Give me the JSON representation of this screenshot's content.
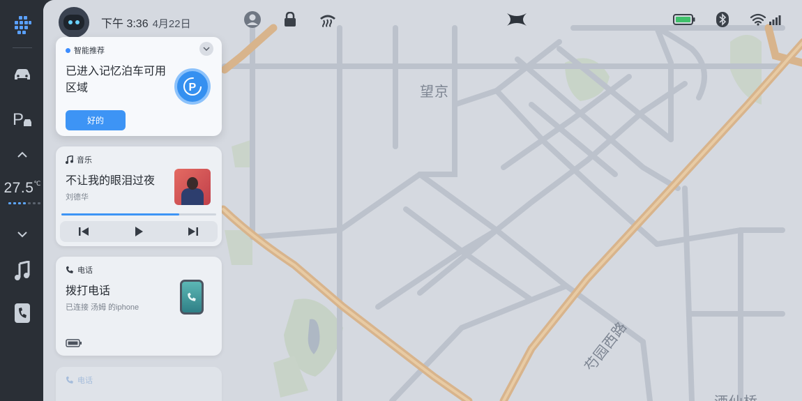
{
  "status_bar": {
    "time": "下午 3:36",
    "date": "4月22日",
    "icons": [
      "assistant-avatar-icon",
      "profile-icon",
      "lock-icon",
      "defrost-icon",
      "brand-logo-icon",
      "battery-icon",
      "bluetooth-icon",
      "wifi-icon",
      "signal-icon"
    ]
  },
  "rail": {
    "items": [
      "apps-icon",
      "car-icon",
      "parking-icon",
      "chevron-up-icon",
      "chevron-down-icon",
      "music-icon",
      "phone-icon"
    ],
    "temperature": "27.5",
    "temperature_unit": "℃",
    "fan_level": 4
  },
  "smart_card": {
    "title": "智能推荐",
    "message_line1": "已进入记忆泊车可用",
    "message_line2": "区域",
    "button_label": "好的"
  },
  "music_card": {
    "title": "音乐",
    "song": "不让我的眼泪过夜",
    "artist": "刘德华",
    "progress": 0.76
  },
  "phone_card": {
    "title": "电话",
    "action": "拨打电话",
    "status": "已连接 汤姆 的iphone"
  },
  "ghost_card": {
    "title": "电话"
  },
  "map": {
    "labels": [
      "望京",
      "芍园西路",
      "酒仙桥"
    ]
  },
  "colors": {
    "accent": "#3d94f5",
    "map_bg": "#d5d9e0",
    "road_major": "#d9b58c"
  }
}
